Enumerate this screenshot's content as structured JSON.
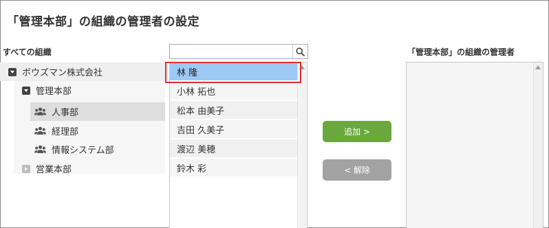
{
  "title": "「管理本部」の組織の管理者の設定",
  "all_orgs_label": "すべての組織",
  "admins_label": "「管理本部」の組織の管理者",
  "tree": {
    "root": {
      "label": "ボウズマン株式会社",
      "icon": "caret-down-icon"
    },
    "level1": [
      {
        "label": "管理本部",
        "icon": "caret-down-icon"
      },
      {
        "label": "営業本部",
        "icon": "caret-right-icon"
      }
    ],
    "level2": [
      {
        "label": "人事部",
        "icon": "group-icon",
        "selected": true
      },
      {
        "label": "経理部",
        "icon": "group-icon"
      },
      {
        "label": "情報システム部",
        "icon": "group-icon"
      }
    ]
  },
  "search": {
    "value": "",
    "placeholder": "",
    "icon": "search-icon"
  },
  "users": [
    {
      "name": "林 隆",
      "selected": true
    },
    {
      "name": "小林 拓也"
    },
    {
      "name": "松本 由美子"
    },
    {
      "name": "吉田 久美子"
    },
    {
      "name": "渡辺 美穂"
    },
    {
      "name": "鈴木 彩"
    }
  ],
  "buttons": {
    "add": "追加 >",
    "remove": "< 解除"
  },
  "colors": {
    "add_button": "#6aa83e",
    "remove_button": "#a2a2a2",
    "selected_user": "#9cc9f6",
    "highlight": "#e02b2b"
  }
}
